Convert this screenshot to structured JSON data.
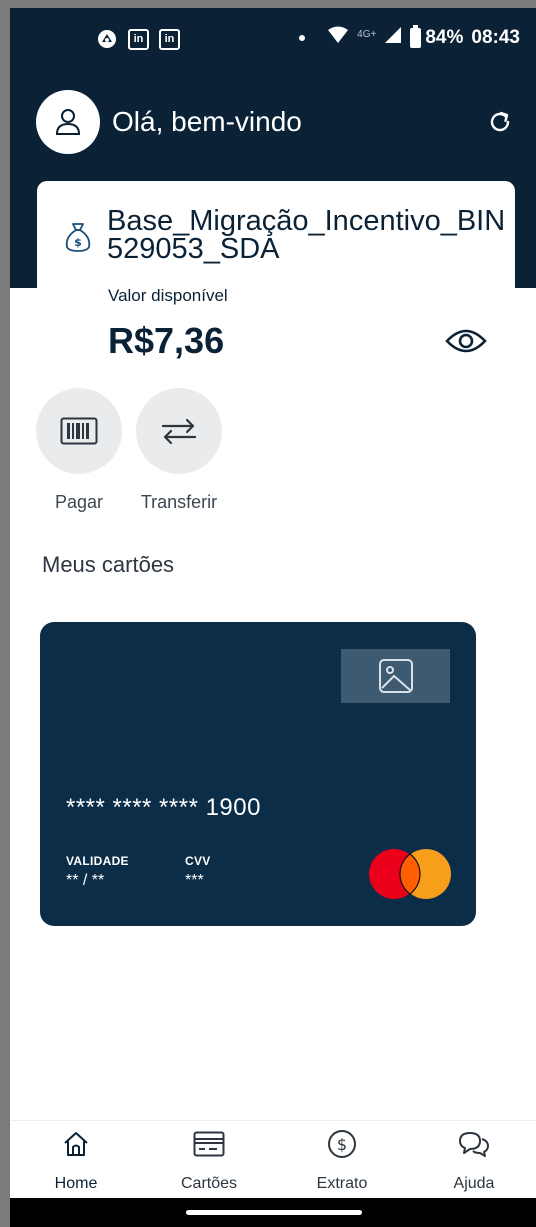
{
  "status_bar": {
    "battery": "84%",
    "time": "08:43",
    "network": "4G+",
    "left_icons": [
      "notification-icon",
      "linkedin-icon",
      "linkedin-icon"
    ]
  },
  "header": {
    "greeting": "Olá, bem-vindo"
  },
  "account": {
    "name": "Base_Migração_Incentivo_BIN 529053_SDA",
    "balance_label": "Valor disponível",
    "balance": "R$7,36"
  },
  "actions": [
    {
      "label": "Pagar",
      "icon": "barcode-icon"
    },
    {
      "label": "Transferir",
      "icon": "transfer-icon"
    }
  ],
  "cards_section": {
    "title": "Meus cartões",
    "card": {
      "number": "**** **** **** 1900",
      "validity_label": "VALIDADE",
      "validity_value": "** / **",
      "cvv_label": "CVV",
      "cvv_value": "***",
      "brand": "mastercard"
    }
  },
  "bottom_nav": [
    {
      "label": "Home",
      "icon": "home-icon",
      "active": true
    },
    {
      "label": "Cartões",
      "icon": "card-icon",
      "active": false
    },
    {
      "label": "Extrato",
      "icon": "dollar-icon",
      "active": false
    },
    {
      "label": "Ajuda",
      "icon": "chat-icon",
      "active": false
    }
  ],
  "colors": {
    "primary": "#0b2236",
    "card_bg": "#0b2d48",
    "action_bg": "#eaebec",
    "mc_red": "#eb001b",
    "mc_orange": "#f79e1b"
  }
}
